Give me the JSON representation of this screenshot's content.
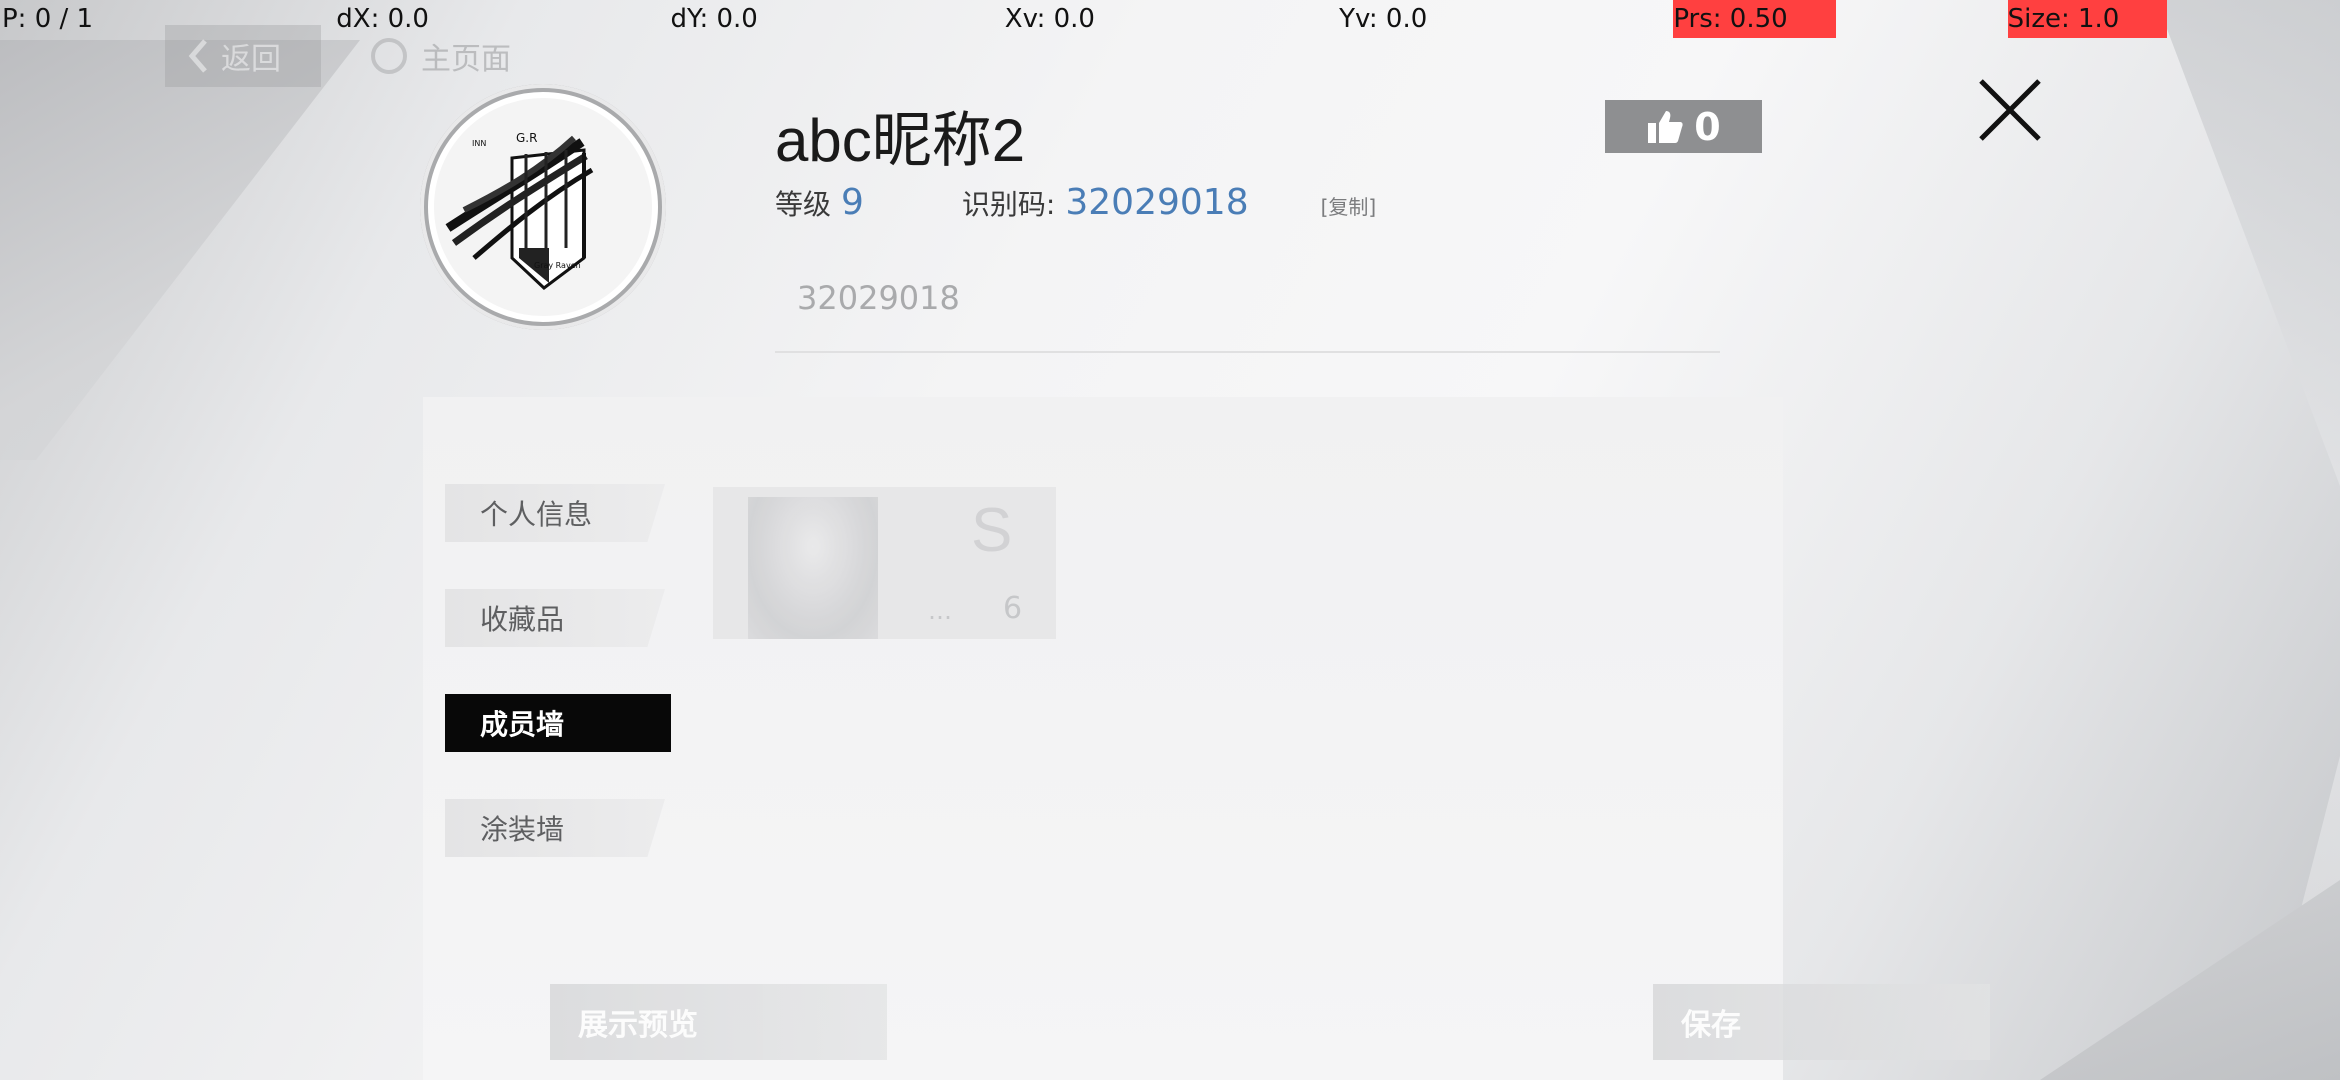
{
  "debug": {
    "p": "P: 0 / 1",
    "dx": "dX: 0.0",
    "dy": "dY: 0.0",
    "xv": "Xv: 0.0",
    "yv": "Yv: 0.0",
    "prs": "Prs: 0.50",
    "size": "Size: 1.0"
  },
  "nav": {
    "back_label": "返回",
    "home_label": "主页面"
  },
  "profile": {
    "nickname": "abc昵称2",
    "likes": "0",
    "level_label": "等级",
    "level_value": "9",
    "id_label": "识别码:",
    "id_value": "32029018",
    "copy_label": "[复制]",
    "signature": "32029018",
    "emblem_top": "G.R",
    "emblem_left": "INN",
    "emblem_bottom": "Gray Raven"
  },
  "menu": {
    "items": [
      {
        "label": "个人信息"
      },
      {
        "label": "收藏品"
      },
      {
        "label": "成员墙"
      },
      {
        "label": "涂装墙"
      }
    ]
  },
  "member_card": {
    "rank": "S",
    "stat": "…",
    "level": "6"
  },
  "buttons": {
    "preview": "展示预览",
    "save": "保存"
  },
  "colors": {
    "accent_blue": "#4a7db6",
    "debug_red": "#ff4040",
    "active_menu": "#080808"
  }
}
